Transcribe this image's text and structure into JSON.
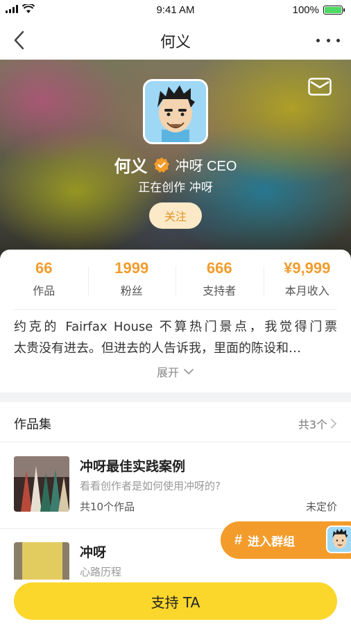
{
  "status_bar": {
    "time": "9:41 AM",
    "battery": "100%"
  },
  "nav": {
    "title": "何义"
  },
  "profile": {
    "name": "何义",
    "role": "冲呀 CEO",
    "subtitle": "正在创作 冲呀",
    "follow_label": "关注"
  },
  "stats": [
    {
      "value": "66",
      "label": "作品"
    },
    {
      "value": "1999",
      "label": "粉丝"
    },
    {
      "value": "666",
      "label": "支持者"
    },
    {
      "value": "¥9,999",
      "label": "本月收入"
    }
  ],
  "bio": {
    "line1": "约克的 Fairfax House 不算热门景点，我觉得门票",
    "line2": "太贵没有进去。但进去的人告诉我，里面的陈设和…",
    "expand_label": "展开"
  },
  "collection": {
    "title": "作品集",
    "count": "共3个",
    "items": [
      {
        "title": "冲呀最佳实践案例",
        "desc": "看看创作者是如何使用冲呀的?",
        "works": "共10个作品",
        "price": "未定价"
      },
      {
        "title": "冲呀",
        "desc": "心路历程"
      }
    ]
  },
  "group_button": {
    "label": "进入群组"
  },
  "bottom": {
    "support_label": "支持 TA"
  },
  "colors": {
    "accent": "#f39c2c",
    "support": "#fbd72b",
    "follow_bg": "#fbe9c7"
  }
}
